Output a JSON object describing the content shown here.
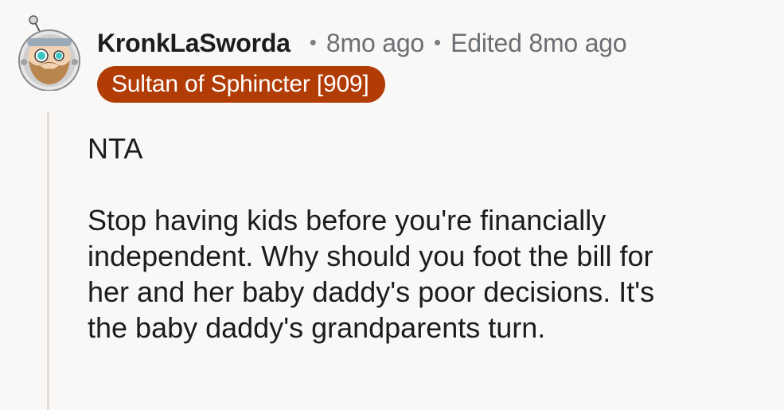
{
  "comment": {
    "author": "KronkLaSworda",
    "separator": "•",
    "posted_time": "8mo ago",
    "edited_label": "Edited 8mo ago",
    "flair": "Sultan of Sphincter [909]",
    "flair_color": "#b23c05",
    "avatar_icon": "astronaut-helmet-snoo-avatar",
    "body": {
      "paragraph1": "NTA",
      "paragraph2_lines": [
        "Stop having kids before you're financially",
        "independent. Why should you foot the bill for",
        "her and her baby daddy's poor decisions. It's",
        "the baby daddy's grandparents turn."
      ]
    }
  }
}
